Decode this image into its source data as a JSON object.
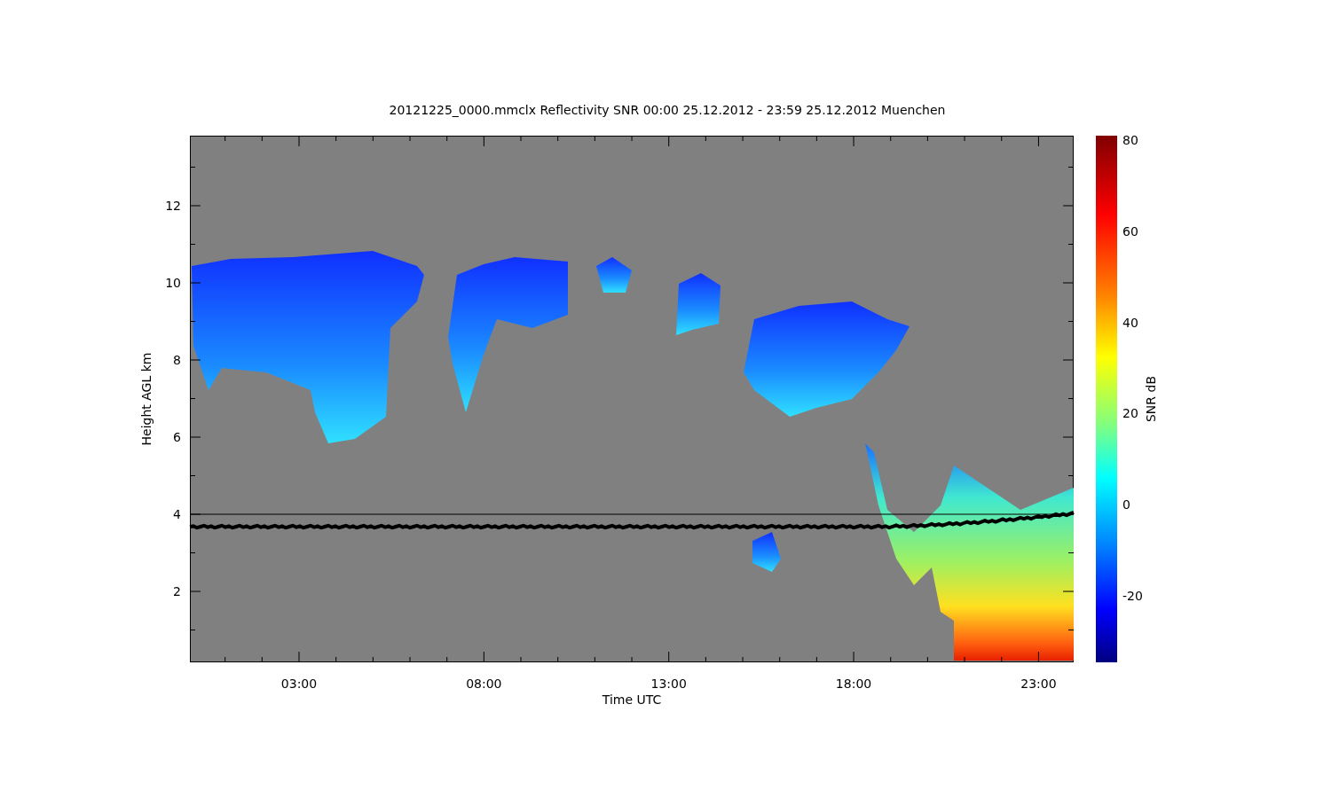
{
  "title": "20121225_0000.mmclx Reflectivity SNR   00:00 25.12.2012 - 23:59 25.12.2012 Muenchen",
  "plot": {
    "x_axis_label": "Time UTC",
    "y_axis_label": "Height AGL km",
    "x_tick_labels": [
      "03:00",
      "08:00",
      "13:00",
      "18:00",
      "23:00"
    ],
    "y_tick_labels": [
      "12",
      "10",
      "8",
      "6",
      "4",
      "2"
    ]
  },
  "colorbar": {
    "label": "SNR dB",
    "tick_labels": [
      "80",
      "60",
      "40",
      "20",
      "0",
      "-20"
    ]
  }
}
